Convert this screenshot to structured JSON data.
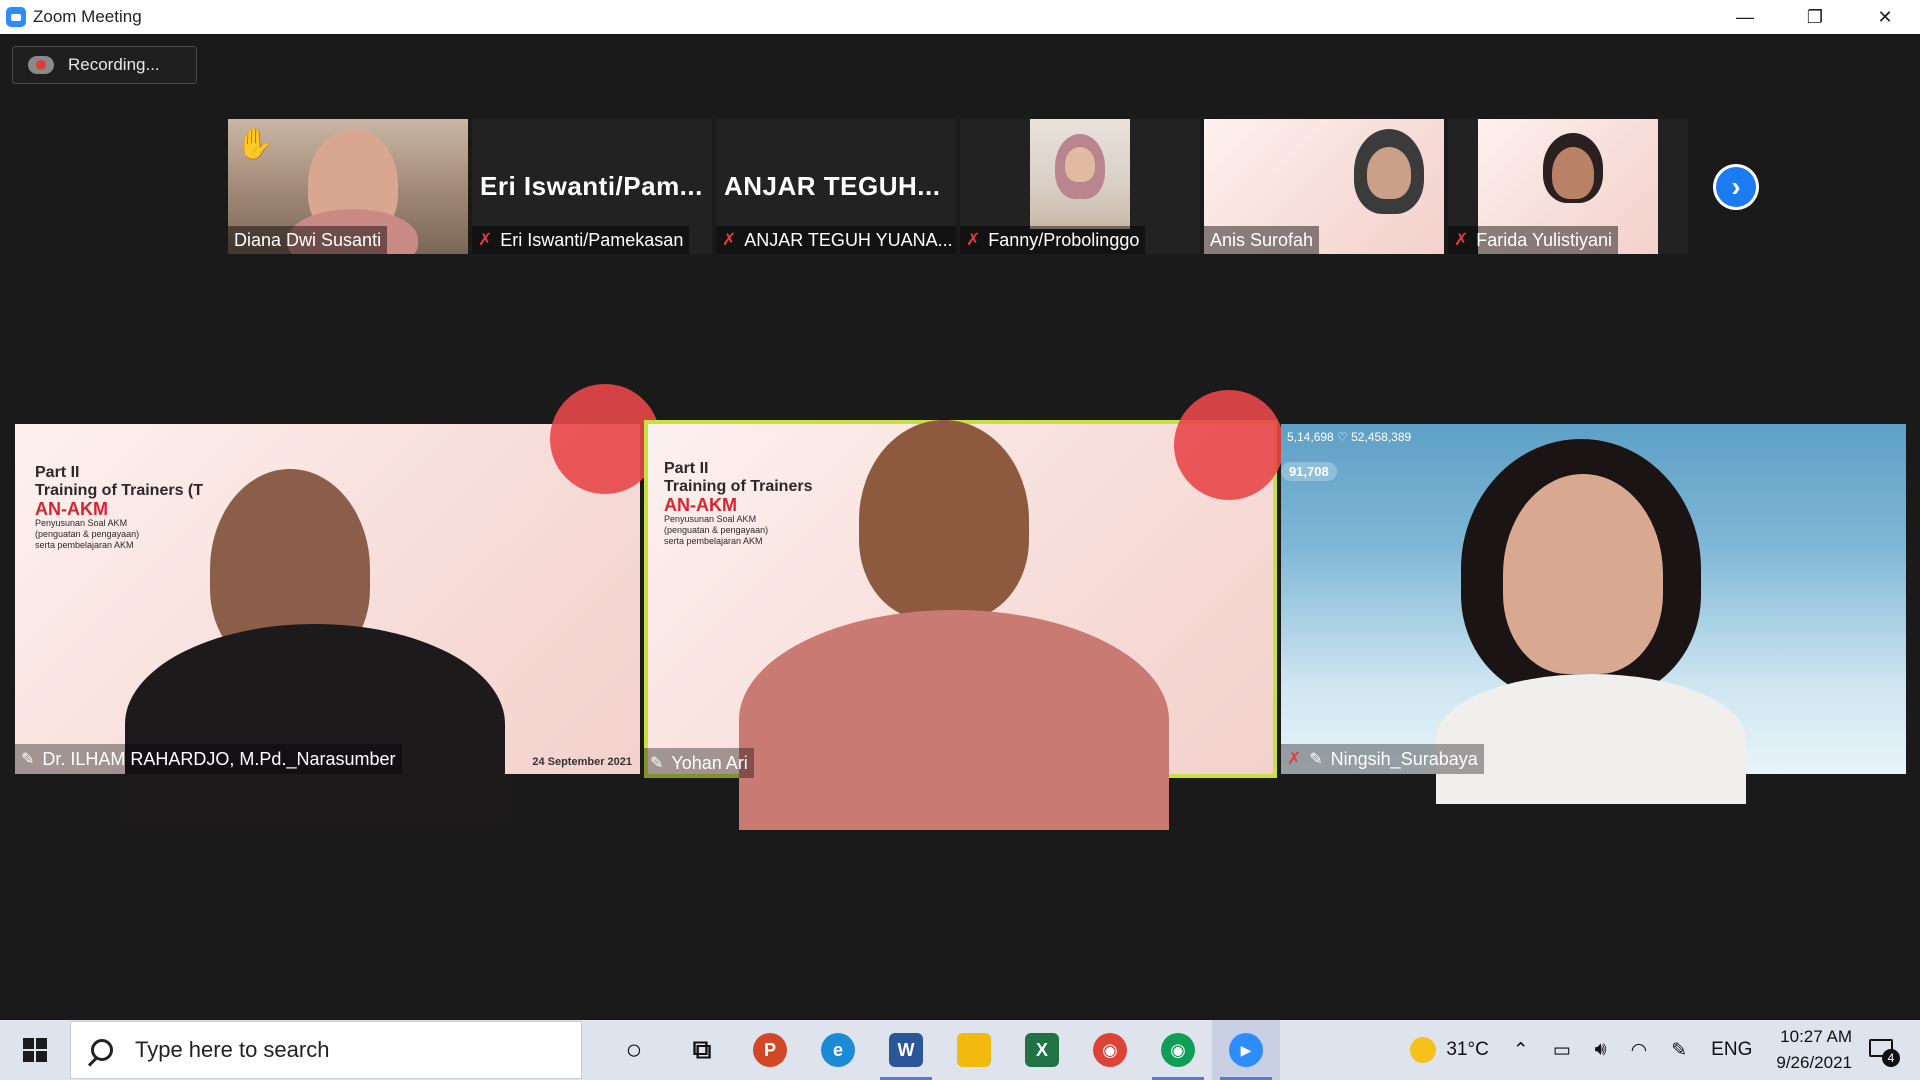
{
  "window": {
    "title": "Zoom Meeting",
    "minimize_glyph": "—",
    "restore_glyph": "❐",
    "close_glyph": "✕"
  },
  "recording": {
    "label": "Recording..."
  },
  "thumbnails": [
    {
      "name": "Diana Dwi Susanti",
      "has_video": true,
      "hand_raised": true,
      "muted": false
    },
    {
      "name": "Eri Iswanti/Pamekasan",
      "display_text": "Eri  Iswanti/Pam...",
      "has_video": false,
      "muted": true
    },
    {
      "name": "ANJAR TEGUH YUANA...",
      "display_text": "ANJAR  TEGUH...",
      "has_video": false,
      "muted": true
    },
    {
      "name": "Fanny/Probolinggo",
      "has_video": true,
      "muted": true
    },
    {
      "name": "Anis Surofah",
      "has_video": true,
      "muted": false
    },
    {
      "name": "Farida Yulistiyani",
      "has_video": true,
      "muted": true
    }
  ],
  "main_videos": [
    {
      "name": "Dr. ILHAM RAHARDJO, M.Pd._Narasumber",
      "slide_part": "Part II",
      "slide_title": "Training of Trainers (T",
      "slide_subtitle": "AN-AKM",
      "slide_lines": [
        "Penyusunan Soal AKM",
        "(penguatan & pengayaan)",
        "serta pembelajaran AKM"
      ],
      "date": "24 September 2021",
      "active": false,
      "muted": false
    },
    {
      "name": "Yohan Ari",
      "slide_part": "Part II",
      "slide_title": "Training of Trainers",
      "slide_subtitle": "AN-AKM",
      "slide_lines": [
        "Penyusunan Soal AKM",
        "(penguatan & pengayaan)",
        "serta pembelajaran AKM"
      ],
      "active": true,
      "muted": false
    },
    {
      "name": "Ningsih_Surabaya",
      "overlay_counts": "5,14,698   ♡ 52,458,389",
      "overlay_badge": "91,708",
      "active": false,
      "muted": true
    }
  ],
  "taskbar": {
    "search_placeholder": "Type here to search",
    "apps": [
      {
        "name": "cortana",
        "glyph": "○",
        "color": "#dfe3ee"
      },
      {
        "name": "task-view",
        "glyph": "⧉",
        "color": "#dfe3ee"
      },
      {
        "name": "powerpoint",
        "glyph": "P",
        "color": "#d24726"
      },
      {
        "name": "edge",
        "glyph": "e",
        "color": "#1c8bd6"
      },
      {
        "name": "word",
        "glyph": "W",
        "color": "#2b579a"
      },
      {
        "name": "file-explorer",
        "glyph": "▭",
        "color": "#f2b90f"
      },
      {
        "name": "excel",
        "glyph": "X",
        "color": "#217346"
      },
      {
        "name": "chrome",
        "glyph": "◉",
        "color": "#db4437"
      },
      {
        "name": "chrome-profile",
        "glyph": "◉",
        "color": "#0f9d58"
      },
      {
        "name": "zoom",
        "glyph": "▶",
        "color": "#2d8cff"
      }
    ],
    "weather": "31°C",
    "language": "ENG",
    "time": "10:27 AM",
    "date": "9/26/2021",
    "notification_count": "4"
  }
}
